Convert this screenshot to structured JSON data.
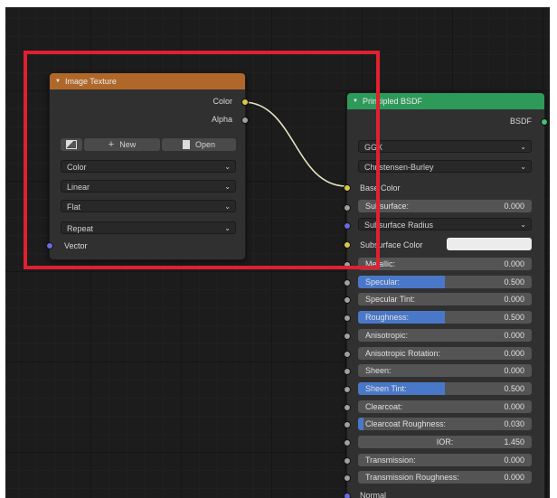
{
  "image_texture": {
    "title": "Image Texture",
    "outputs": [
      "Color",
      "Alpha"
    ],
    "new_label": "New",
    "open_label": "Open",
    "dropdowns": [
      "Color",
      "Linear",
      "Flat",
      "Repeat"
    ],
    "input_vector": "Vector"
  },
  "principled": {
    "title": "Principled BSDF",
    "output": "BSDF",
    "distribution": "GGX",
    "subsurface_method": "Christensen-Burley",
    "base_color": "Base Color",
    "subsurface": {
      "label": "Subsurface:",
      "value": "0.000"
    },
    "subsurface_radius": "Subsurface Radius",
    "subsurface_color": "Subsurface Color",
    "sliders": [
      {
        "label": "Metallic:",
        "value": "0.000",
        "fill": 0.0
      },
      {
        "label": "Specular:",
        "value": "0.500",
        "fill": 0.5
      },
      {
        "label": "Specular Tint:",
        "value": "0.000",
        "fill": 0.0
      },
      {
        "label": "Roughness:",
        "value": "0.500",
        "fill": 0.5
      },
      {
        "label": "Anisotropic:",
        "value": "0.000",
        "fill": 0.0
      },
      {
        "label": "Anisotropic Rotation:",
        "value": "0.000",
        "fill": 0.0
      },
      {
        "label": "Sheen:",
        "value": "0.000",
        "fill": 0.0
      },
      {
        "label": "Sheen Tint:",
        "value": "0.500",
        "fill": 0.5
      },
      {
        "label": "Clearcoat:",
        "value": "0.000",
        "fill": 0.0
      },
      {
        "label": "Clearcoat Roughness:",
        "value": "0.030",
        "fill": 0.03
      }
    ],
    "ior": {
      "label": "IOR:",
      "value": "1.450"
    },
    "sliders2": [
      {
        "label": "Transmission:",
        "value": "0.000",
        "fill": 0.0
      },
      {
        "label": "Transmission Roughness:",
        "value": "0.000",
        "fill": 0.0
      }
    ],
    "normal": "Normal"
  },
  "colors": {
    "image_texture_header": "#b0682a",
    "principled_header": "#2e9a5a",
    "highlight": "#e02030",
    "slider_fill": "#4a78c8"
  },
  "icons": [
    "image-browse-icon",
    "plus-icon",
    "file-icon",
    "collapse-icon",
    "chevron-down-icon"
  ]
}
